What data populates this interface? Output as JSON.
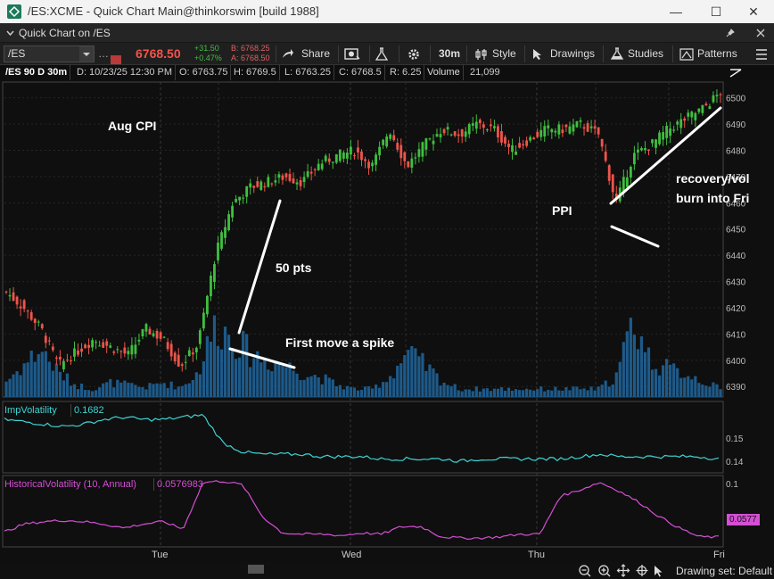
{
  "window": {
    "title": "/ES:XCME - Quick Chart Main@thinkorswim [build 1988]",
    "minimize": "—",
    "maximize": "☐",
    "close": "✕"
  },
  "panel": {
    "title": "Quick Chart on /ES",
    "collapse_icon": "chevron-down-icon",
    "pin_icon": "pin-icon",
    "close_icon": "close-icon"
  },
  "toolbar": {
    "symbol": "/ES",
    "more": "…",
    "last_price": "6768.50",
    "net_change": "+31.50",
    "pct_change": "+0.47%",
    "bid": "B: 6768.25",
    "ask": "A: 6768.50",
    "share": "Share",
    "aggregation": "30m",
    "style": "Style",
    "drawings": "Drawings",
    "studies": "Studies",
    "patterns": "Patterns",
    "colors": {
      "price": "#f0544a",
      "up": "#3fbf3f",
      "bid": "#e06060",
      "ask": "#e06060"
    }
  },
  "infobar": {
    "symbol": "/ES 90 D 30m",
    "date": "D: 10/23/25 12:30 PM",
    "open": "O: 6763.75",
    "high": "H: 6769.5",
    "low": "L: 6763.25",
    "close": "C: 6768.5",
    "range": "R: 6.25",
    "volume_label": "Volume",
    "volume_value": "21,099"
  },
  "annotations": {
    "aug_cpi": "Aug CPI",
    "pts": "50 pts",
    "first_move": "First move a spike",
    "ppi": "PPI",
    "recovery": "recovery/vol",
    "burn": "burn into Fri"
  },
  "studies": {
    "imp_label": "ImpVolatility",
    "imp_value": "0.1682",
    "hv_label": "HistoricalVolatility (10, Annual)",
    "hv_value": "0.0576983",
    "hv_marker": "0.0577"
  },
  "bottom": {
    "drawing_set": "Drawing set: Default"
  },
  "chart_data": [
    {
      "type": "candlestick",
      "title": "/ES 30m",
      "y_axis_ticks": [
        6390,
        6400,
        6410,
        6420,
        6430,
        6440,
        6450,
        6460,
        6470,
        6480,
        6490,
        6500
      ],
      "ylim": [
        6386,
        6506
      ],
      "x_tick_labels": [
        "Tue",
        "Wed",
        "Thu",
        "Fri"
      ],
      "close_path": [
        6426,
        6420,
        6412,
        6398,
        6403,
        6408,
        6405,
        6402,
        6412,
        6408,
        6398,
        6406,
        6440,
        6460,
        6466,
        6468,
        6470,
        6468,
        6475,
        6478,
        6480,
        6474,
        6488,
        6474,
        6482,
        6488,
        6486,
        6490,
        6488,
        6480,
        6484,
        6488,
        6488,
        6490,
        6486,
        6460,
        6478,
        6482,
        6488,
        6492,
        6496,
        6502
      ],
      "volume_path": [
        20,
        40,
        60,
        30,
        15,
        10,
        18,
        15,
        12,
        18,
        12,
        30,
        90,
        75,
        55,
        45,
        40,
        30,
        25,
        15,
        10,
        10,
        25,
        55,
        40,
        20,
        10,
        10,
        10,
        10,
        10,
        10,
        10,
        10,
        10,
        25,
        95,
        45,
        35,
        30,
        20,
        10
      ]
    },
    {
      "type": "line",
      "name": "ImpVolatility",
      "y_axis_ticks": [
        0.14,
        0.15
      ],
      "ylim": [
        0.135,
        0.165
      ],
      "values": [
        0.158,
        0.157,
        0.156,
        0.155,
        0.156,
        0.158,
        0.159,
        0.158,
        0.158,
        0.159,
        0.16,
        0.148,
        0.144,
        0.143,
        0.143,
        0.143,
        0.142,
        0.142,
        0.142,
        0.141,
        0.141,
        0.141,
        0.141,
        0.14,
        0.141,
        0.141,
        0.141,
        0.141,
        0.141,
        0.142,
        0.143,
        0.142,
        0.142,
        0.142,
        0.142,
        0.142,
        0.141
      ]
    },
    {
      "type": "line",
      "name": "HistoricalVolatility (10, Annual)",
      "y_axis_ticks": [
        0.1
      ],
      "ylim": [
        0.05,
        0.105
      ],
      "values": [
        0.062,
        0.068,
        0.07,
        0.071,
        0.07,
        0.068,
        0.065,
        0.068,
        0.07,
        0.064,
        0.101,
        0.102,
        0.099,
        0.074,
        0.061,
        0.06,
        0.06,
        0.059,
        0.061,
        0.06,
        0.066,
        0.066,
        0.058,
        0.057,
        0.057,
        0.058,
        0.06,
        0.06,
        0.09,
        0.095,
        0.101,
        0.094,
        0.085,
        0.074,
        0.065,
        0.058,
        0.0577
      ]
    }
  ]
}
